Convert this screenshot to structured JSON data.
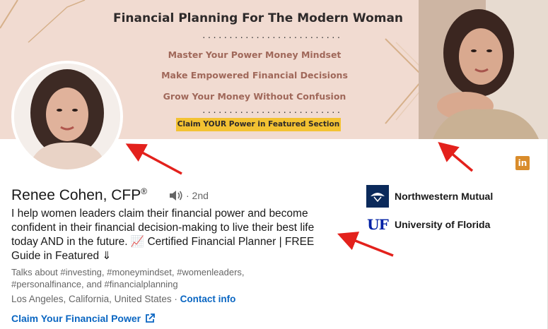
{
  "banner": {
    "title": "Financial Planning For The Modern Woman",
    "dots": "..........................",
    "lines": [
      "Master Your Power Money Mindset",
      "Make Empowered Financial Decisions",
      "Grow Your Money Without Confusion"
    ],
    "cta": "Claim YOUR Power in Featured Section"
  },
  "profile": {
    "name": "Renee Cohen, CFP",
    "registered": "®",
    "degree": "· 2nd",
    "headline": "I help women leaders claim their financial power and become confident in their financial decision-making to live their best life today AND in the future. 📈 Certified Financial Planner | FREE Guide in Featured ⇓",
    "talks_about": "Talks about #investing, #moneymindset, #womenleaders, #personalfinance, and #financialplanning",
    "location": "Los Angeles, California, United States",
    "separator": " · ",
    "contact_info": "Contact info",
    "website": "Claim Your Financial Power"
  },
  "orgs": [
    {
      "name": "Northwestern Mutual",
      "icon": "northwestern-mutual-logo"
    },
    {
      "name": "University of Florida",
      "icon": "uf-logo",
      "logo_text": "UF"
    }
  ],
  "linkedin_badge": "in",
  "colors": {
    "link": "#0a66c2",
    "banner_bg": "#f1dbd1",
    "banner_accent": "#a0685a",
    "cta_bg": "#f3c232",
    "arrow": "#e3211c",
    "li_badge": "#d98c2b"
  }
}
